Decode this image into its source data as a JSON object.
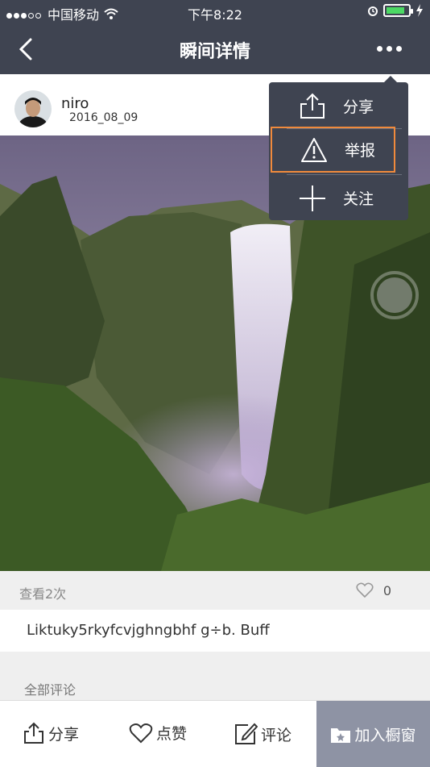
{
  "status_bar": {
    "carrier": "中国移动",
    "time": "下午8:22"
  },
  "nav": {
    "title": "瞬间详情"
  },
  "post": {
    "username": "niro",
    "date": "2016_08_09",
    "views": "查看2次",
    "like_count": "0",
    "description": "Liktuky5rkyfcvjghngbhf g÷b. Buff"
  },
  "comments": {
    "title": "全部评论"
  },
  "bottom_bar": {
    "share_label": "分享",
    "like_label": "点赞",
    "comment_label": "评论",
    "cart_label": "加入橱窗"
  },
  "menu": {
    "items": [
      {
        "label": "分享",
        "icon": "share-icon"
      },
      {
        "label": "举报",
        "icon": "warning-icon"
      },
      {
        "label": "关注",
        "icon": "plus-icon"
      }
    ],
    "highlight_color": "#f08a3c"
  },
  "colors": {
    "header_bg": "#3f4451",
    "cart_bg": "#8e93a4",
    "battery_fill": "#4cd964"
  }
}
